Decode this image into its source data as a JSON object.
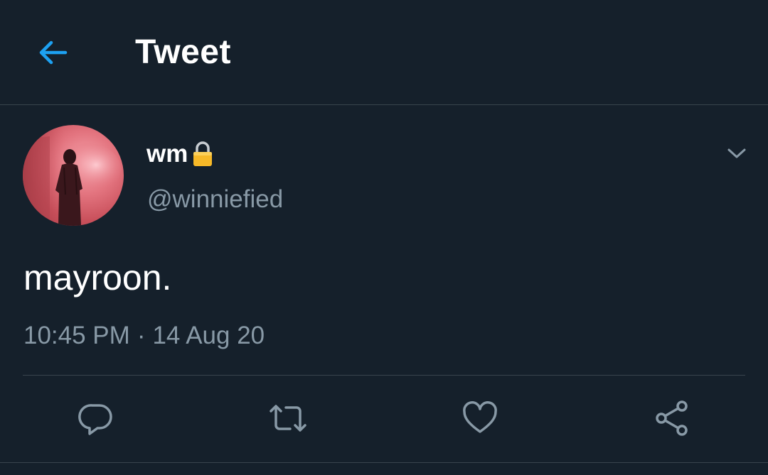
{
  "header": {
    "title": "Tweet",
    "back_icon": "back-arrow-icon"
  },
  "tweet": {
    "author": {
      "display_name": "wm",
      "protected_icon": "lock-icon",
      "handle": "@winniefied"
    },
    "text": "mayroon.",
    "time": "10:45 PM",
    "separator": "·",
    "date": "14 Aug 20",
    "actions": [
      {
        "name": "reply",
        "icon": "reply-icon"
      },
      {
        "name": "retweet",
        "icon": "retweet-icon"
      },
      {
        "name": "like",
        "icon": "heart-icon"
      },
      {
        "name": "share",
        "icon": "share-icon"
      }
    ]
  },
  "colors": {
    "background": "#15202b",
    "accent": "#1da1f2",
    "secondary_text": "#8899a6",
    "divider": "#38444d",
    "lock": "#f7b928"
  }
}
